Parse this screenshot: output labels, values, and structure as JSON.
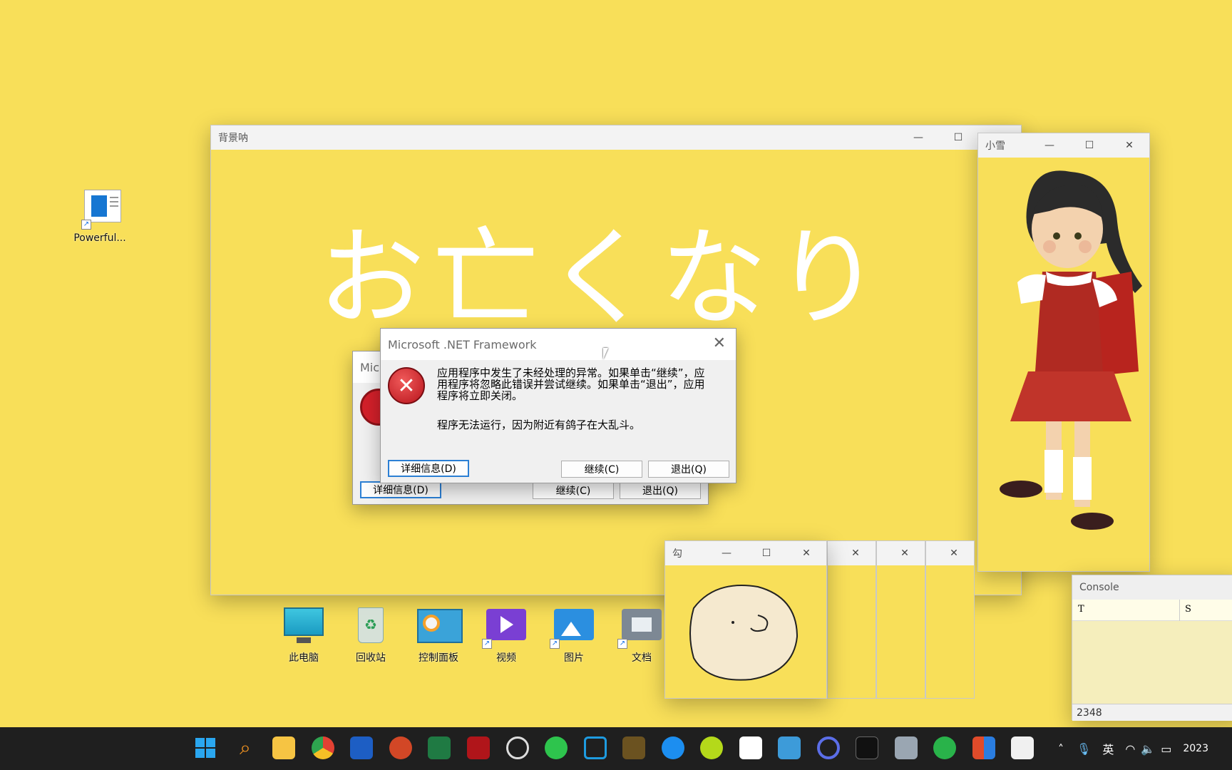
{
  "desktop": {
    "icons": [
      {
        "label": "Powerful..."
      },
      {
        "label": "此电脑"
      },
      {
        "label": "回收站"
      },
      {
        "label": "控制面板"
      },
      {
        "label": "视频"
      },
      {
        "label": "图片"
      },
      {
        "label": "文档"
      }
    ]
  },
  "bg_window": {
    "title": "背景呐",
    "big_text": "お亡くなり"
  },
  "girl_window": {
    "title": "小雪"
  },
  "hamster_windows": [
    {
      "title": "勾"
    }
  ],
  "console": {
    "title": "Console",
    "col1": "T",
    "col2": "S",
    "value": "2348"
  },
  "back_dialog": {
    "title_partial": "Mic",
    "details_btn": "详细信息(D)",
    "continue_btn": "继续(C)",
    "quit_btn": "退出(Q)"
  },
  "dialog": {
    "title": "Microsoft .NET Framework",
    "message": "应用程序中发生了未经处理的异常。如果单击“继续”，应用程序将忽略此错误并尝试继续。如果单击“退出”，应用程序将立即关闭。",
    "detail": "程序无法运行，因为附近有鸽子在大乱斗。",
    "details_btn": "详细信息(D)",
    "continue_btn": "继续(C)",
    "quit_btn": "退出(Q)"
  },
  "taskbar": {
    "ime": "英",
    "clock_partial": "2023"
  },
  "colors": {
    "desktop_bg": "#f8df59",
    "taskbar_bg": "#1f1f1f",
    "error_red": "#d3202a"
  }
}
